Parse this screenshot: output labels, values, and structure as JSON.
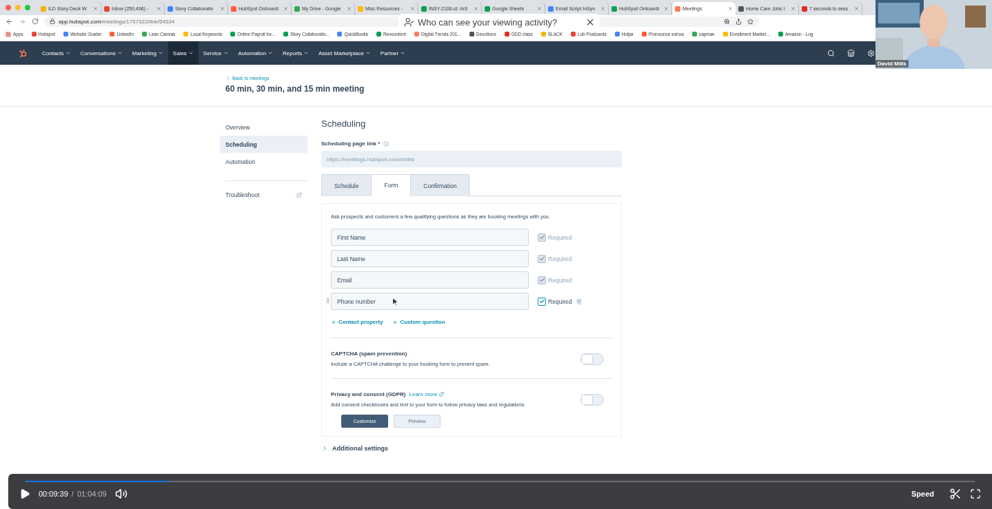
{
  "browser": {
    "tabs": [
      {
        "title": "ILD Story Deck W",
        "selected": false
      },
      {
        "title": "Inbox (250,496) -",
        "selected": false
      },
      {
        "title": "Story Collaborativ",
        "selected": false
      },
      {
        "title": "HubSpot Onboardi",
        "selected": false
      },
      {
        "title": "My Drive - Google",
        "selected": false
      },
      {
        "title": "Misc Resources -",
        "selected": false
      },
      {
        "title": "INSY-2106-st -InS",
        "selected": false
      },
      {
        "title": "Google Sheets",
        "selected": false
      },
      {
        "title": "Email Script InSyn",
        "selected": false
      },
      {
        "title": "HubSpot Onboardi",
        "selected": false
      },
      {
        "title": "Meetings",
        "selected": true
      },
      {
        "title": "Home Care Jobs I",
        "selected": false
      },
      {
        "title": "7 seconds to sess",
        "selected": false
      }
    ],
    "url_host": "app.hubspot.com",
    "url_path": "/meetings/1757322/link/54534",
    "bookmarks": [
      "Apps",
      "Hubspot",
      "Website Grader",
      "LinkedIn",
      "Lean Canvas",
      "Local Keywords",
      "Online Payroll for...",
      "Story Collaborativ...",
      "QuickBooks",
      "Revcontent",
      "Digital Trends 201...",
      "Devotions",
      "GDD class",
      "SLACK",
      "Lob Postcards",
      "Hotjar",
      "Pronounce eshoa",
      "cayman",
      "Enrollment Market...",
      "Amazon - Log"
    ],
    "popup": {
      "text": "Who can see your viewing activity?",
      "close": "×"
    }
  },
  "webcam": {
    "name": "David Mills"
  },
  "nav": {
    "items": [
      {
        "label": "Contacts",
        "selected": false
      },
      {
        "label": "Conversations",
        "selected": false
      },
      {
        "label": "Marketing",
        "selected": false
      },
      {
        "label": "Sales",
        "selected": true
      },
      {
        "label": "Service",
        "selected": false
      },
      {
        "label": "Automation",
        "selected": false
      },
      {
        "label": "Reports",
        "selected": false
      },
      {
        "label": "Asset Marketplace",
        "selected": false
      },
      {
        "label": "Partner",
        "selected": false
      }
    ]
  },
  "header": {
    "back": "Back to meetings",
    "title": "60 min, 30 min, and 15 min meeting"
  },
  "sidebar": {
    "items": [
      {
        "label": "Overview",
        "selected": false
      },
      {
        "label": "Scheduling",
        "selected": true
      },
      {
        "label": "Automation",
        "selected": false
      }
    ],
    "troubleshoot": "Troubleshoot"
  },
  "main": {
    "heading": "Scheduling",
    "link_label": "Scheduling page link *",
    "link_placeholder": "https://meetings.hubspot.com/dmills",
    "tabs": [
      {
        "label": "Schedule",
        "selected": false
      },
      {
        "label": "Form",
        "selected": true
      },
      {
        "label": "Confirmation",
        "selected": false
      }
    ],
    "intro": "Ask prospects and customers a few qualifying questions as they are booking meetings with you.",
    "fields": [
      {
        "label": "First Name",
        "required_label": "Required",
        "checked": true,
        "disabled": true
      },
      {
        "label": "Last Name",
        "required_label": "Required",
        "checked": true,
        "disabled": true
      },
      {
        "label": "Email",
        "required_label": "Required",
        "checked": true,
        "disabled": true
      },
      {
        "label": "Phone number",
        "required_label": "Required",
        "checked": true,
        "disabled": false
      }
    ],
    "add_links": [
      "Contact property",
      "Custom question"
    ],
    "captcha": {
      "title": "CAPTCHA (spam prevention)",
      "description": "Include a CAPTCHA challenge to your booking form to prevent spam.",
      "on": false
    },
    "privacy": {
      "title": "Privacy and consent (GDPR)",
      "link": "Learn more",
      "description": "Add consent checkboxes and text to your form to follow privacy laws and regulations.",
      "on": false,
      "buttons": [
        "Customize",
        "Preview"
      ]
    },
    "additional": "Additional settings"
  },
  "player": {
    "level": 0.151,
    "time": "00:09:39",
    "separator": "/",
    "duration": "01:04:09",
    "speed": "Speed"
  }
}
